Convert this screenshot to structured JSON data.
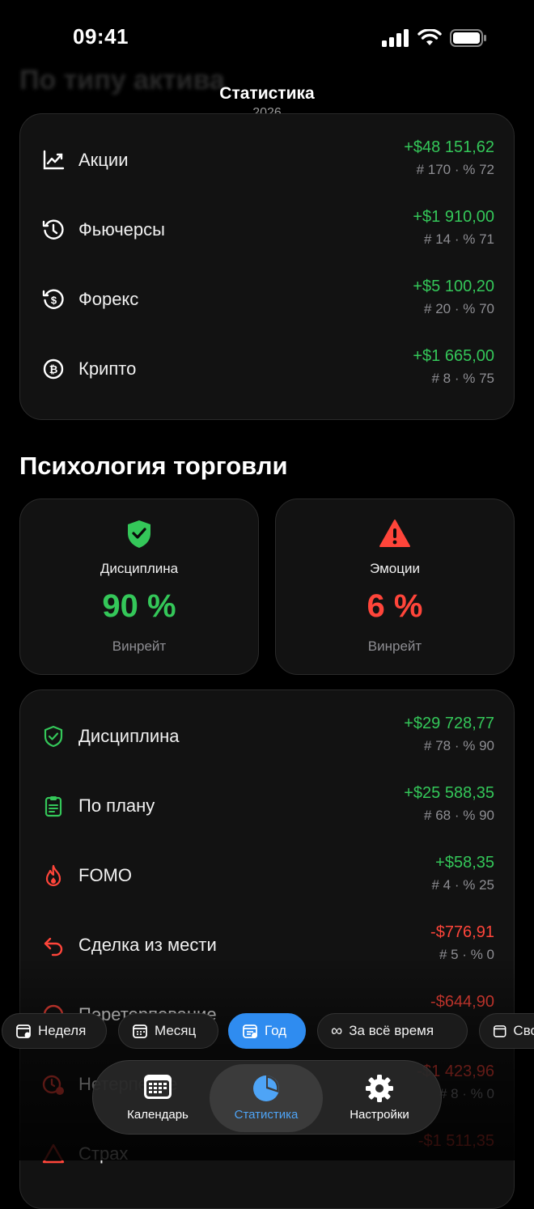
{
  "status": {
    "time": "09:41"
  },
  "header": {
    "background_title": "По типу актива",
    "title": "Статистика",
    "subtitle": "2026"
  },
  "asset_types": [
    {
      "icon": "stock-chart-icon",
      "label": "Акции",
      "amount": "+$48 151,62",
      "meta": "# 170 · % 72",
      "tone": "pos"
    },
    {
      "icon": "futures-clock-icon",
      "label": "Фьючерсы",
      "amount": "+$1 910,00",
      "meta": "# 14 · % 71",
      "tone": "pos"
    },
    {
      "icon": "forex-dollar-icon",
      "label": "Форекс",
      "amount": "+$5 100,20",
      "meta": "# 20 · % 70",
      "tone": "pos"
    },
    {
      "icon": "bitcoin-icon",
      "label": "Крипто",
      "amount": "+$1 665,00",
      "meta": "# 8 · % 75",
      "tone": "pos"
    }
  ],
  "psychology": {
    "title": "Психология торговли",
    "discipline": {
      "title": "Дисциплина",
      "value": "90 %",
      "subtitle": "Винрейт",
      "color": "#34c759"
    },
    "emotions": {
      "title": "Эмоции",
      "value": "6 %",
      "subtitle": "Винрейт",
      "color": "#ff453a"
    }
  },
  "psy_rows": [
    {
      "label": "Дисциплина",
      "amount": "+$29 728,77",
      "meta": "# 78 · % 90",
      "tone": "pos"
    },
    {
      "label": "По плану",
      "amount": "+$25 588,35",
      "meta": "# 68 · % 90",
      "tone": "pos"
    },
    {
      "label": "FOMO",
      "amount": "+$58,35",
      "meta": "# 4 · % 25",
      "tone": "pos"
    },
    {
      "label": "Сделка из мести",
      "amount": "-$776,91",
      "meta": "# 5 · % 0",
      "tone": "neg"
    },
    {
      "label": "Перетерпевание",
      "amount": "-$644,90",
      "meta": "",
      "tone": "neg"
    },
    {
      "label": "Нетерпение",
      "amount": "-$1 423,96",
      "meta": "# 8 · % 0",
      "tone": "neg"
    },
    {
      "label": "Страх",
      "amount": "-$1 511,35",
      "meta": "",
      "tone": "neg"
    }
  ],
  "period_filter": {
    "chips": [
      "Неделя",
      "Месяц",
      "Год",
      "За всё время",
      "Сво"
    ],
    "selected": "Год"
  },
  "tabbar": {
    "calendar": "Календарь",
    "statistics": "Статистика",
    "settings": "Настройки",
    "selected": "Статистика"
  }
}
